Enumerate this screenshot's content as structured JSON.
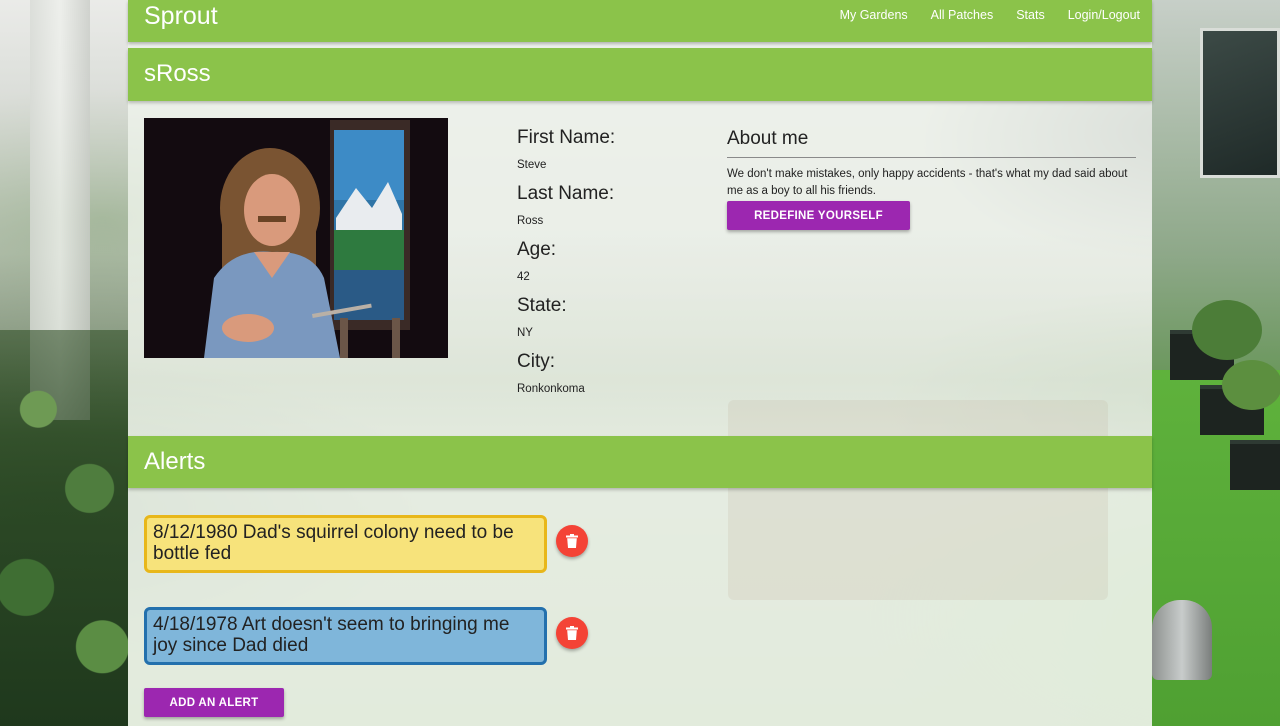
{
  "app": {
    "brand": "Sprout",
    "nav": [
      "My Gardens",
      "All Patches",
      "Stats",
      "Login/Logout"
    ]
  },
  "profile": {
    "username": "sRoss",
    "fields": [
      {
        "label": "First Name:",
        "value": "Steve"
      },
      {
        "label": "Last Name:",
        "value": "Ross"
      },
      {
        "label": "Age:",
        "value": "42"
      },
      {
        "label": "State:",
        "value": "NY"
      },
      {
        "label": "City:",
        "value": "Ronkonkoma"
      }
    ],
    "about_title": "About me",
    "about_text": "We don't make mistakes, only happy accidents - that's what my dad said about me as a boy to all his friends.",
    "redefine_label": "Redefine yourself"
  },
  "alerts": {
    "title": "Alerts",
    "items": [
      {
        "text": "8/12/1980 Dad's squirrel colony need to be bottle fed",
        "color": "yellow",
        "border": "#e8b71a",
        "bg": "#f7e37b"
      },
      {
        "text": "4/18/1978 Art doesn't seem to bringing me joy since Dad died",
        "color": "blue",
        "border": "#2370ad",
        "bg": "#7fb6da"
      }
    ],
    "delete_icon": "trash-icon",
    "add_label": "Add an alert"
  },
  "colors": {
    "primary": "#8bc34a",
    "accent": "#9c27b0",
    "danger": "#f44336"
  }
}
